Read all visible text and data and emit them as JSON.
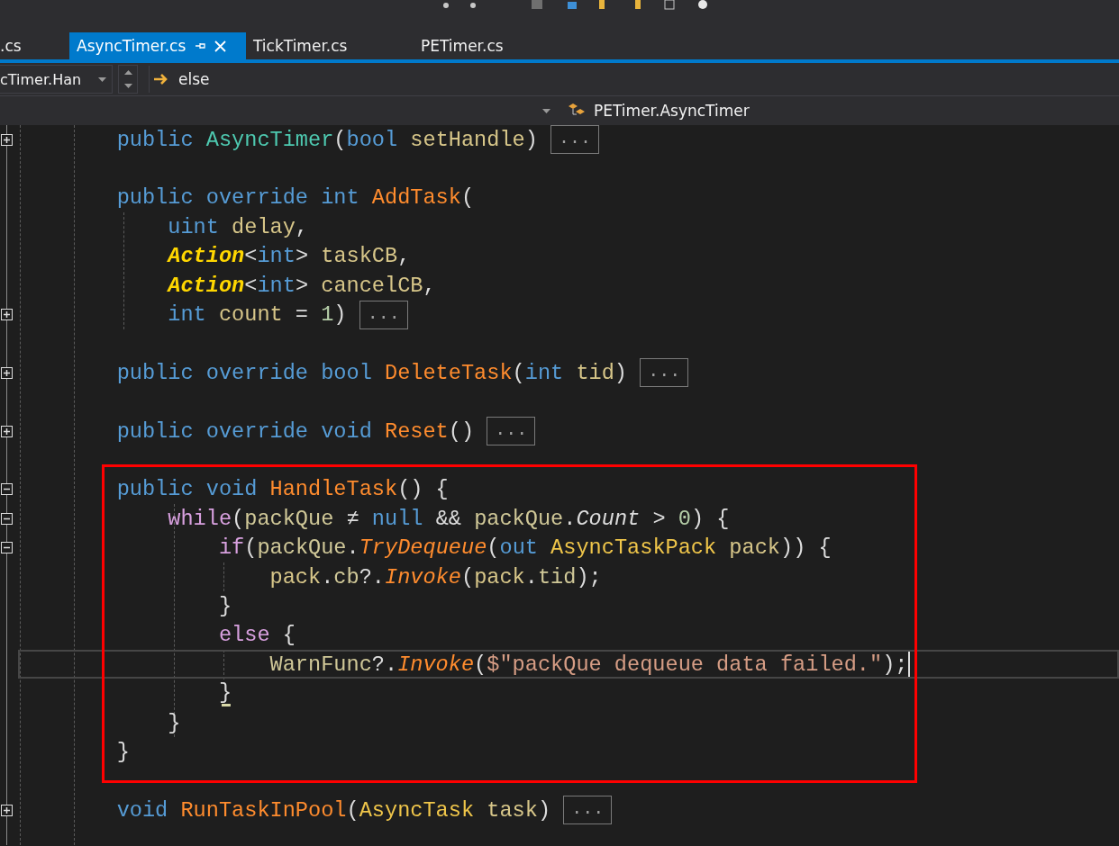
{
  "tabs": [
    {
      "label": ".cs",
      "selected": false
    },
    {
      "label": "AsyncTimer.cs",
      "selected": true
    },
    {
      "label": "TickTimer.cs",
      "selected": false
    },
    {
      "label": "PETimer.cs",
      "selected": false
    }
  ],
  "navigation": {
    "member": "cTimer.Han",
    "scope": "else",
    "type": "PETimer.AsyncTimer"
  },
  "code": {
    "lines_before_box": [
      {
        "collapsed": true,
        "current": false,
        "tokens": [
          {
            "text": "    public ",
            "kind": "kw"
          },
          {
            "text": "AsyncTimer",
            "kind": "cls"
          },
          {
            "text": "(",
            "kind": "pl"
          },
          {
            "text": "bool ",
            "kind": "kw"
          },
          {
            "text": "setHandle",
            "kind": "prm"
          },
          {
            "text": ") ",
            "kind": "pl"
          },
          {
            "text": "...",
            "kind": "collapsed"
          }
        ]
      },
      {
        "current": false
      },
      {
        "current": false,
        "tokens": [
          {
            "text": "    public override int ",
            "kind": "kw"
          },
          {
            "text": "AddTask",
            "kind": "fn"
          },
          {
            "text": "(",
            "kind": "pl"
          }
        ]
      },
      {
        "current": false,
        "tokens": [
          {
            "text": "        uint ",
            "kind": "kw"
          },
          {
            "text": "delay",
            "kind": "prm"
          },
          {
            "text": ",",
            "kind": "pl"
          }
        ]
      },
      {
        "current": false,
        "tokens": [
          {
            "text": "        Action",
            "kind": "dlg"
          },
          {
            "text": "<",
            "kind": "pl"
          },
          {
            "text": "int",
            "kind": "kw"
          },
          {
            "text": "> ",
            "kind": "pl"
          },
          {
            "text": "taskCB",
            "kind": "prm"
          },
          {
            "text": ",",
            "kind": "pl"
          }
        ]
      },
      {
        "current": false,
        "tokens": [
          {
            "text": "        Action",
            "kind": "dlg"
          },
          {
            "text": "<",
            "kind": "pl"
          },
          {
            "text": "int",
            "kind": "kw"
          },
          {
            "text": "> ",
            "kind": "pl"
          },
          {
            "text": "cancelCB",
            "kind": "prm"
          },
          {
            "text": ",",
            "kind": "pl"
          }
        ]
      },
      {
        "collapsed": true,
        "current": false,
        "tokens": [
          {
            "text": "        int ",
            "kind": "kw"
          },
          {
            "text": "count",
            "kind": "prm"
          },
          {
            "text": " = ",
            "kind": "pl"
          },
          {
            "text": "1",
            "kind": "num"
          },
          {
            "text": ") ",
            "kind": "pl"
          },
          {
            "text": "...",
            "kind": "collapsed"
          }
        ]
      },
      {
        "current": false
      },
      {
        "collapsed": true,
        "current": false,
        "tokens": [
          {
            "text": "    public override bool ",
            "kind": "kw"
          },
          {
            "text": "DeleteTask",
            "kind": "fn"
          },
          {
            "text": "(",
            "kind": "pl"
          },
          {
            "text": "int ",
            "kind": "kw"
          },
          {
            "text": "tid",
            "kind": "prm"
          },
          {
            "text": ") ",
            "kind": "pl"
          },
          {
            "text": "...",
            "kind": "collapsed"
          }
        ]
      },
      {
        "current": false
      },
      {
        "collapsed": true,
        "current": false,
        "tokens": [
          {
            "text": "    public override void ",
            "kind": "kw"
          },
          {
            "text": "Reset",
            "kind": "fn"
          },
          {
            "text": "() ",
            "kind": "pl"
          },
          {
            "text": "...",
            "kind": "collapsed"
          }
        ]
      },
      {
        "current": false
      }
    ],
    "boxed_lines": [
      {
        "collapsed": false,
        "current": false,
        "tokens": [
          {
            "text": "    public void ",
            "kind": "kw"
          },
          {
            "text": "HandleTask",
            "kind": "fn"
          },
          {
            "text": "() {",
            "kind": "pl"
          }
        ]
      },
      {
        "collapsed": false,
        "current": false,
        "tokens": [
          {
            "text": "        while",
            "kind": "ctl"
          },
          {
            "text": "(",
            "kind": "pl"
          },
          {
            "text": "packQue",
            "kind": "fld"
          },
          {
            "text": " ≠ ",
            "kind": "pl"
          },
          {
            "text": "null",
            "kind": "kw"
          },
          {
            "text": " && ",
            "kind": "pl"
          },
          {
            "text": "packQue",
            "kind": "fld"
          },
          {
            "text": ".",
            "kind": "pl"
          },
          {
            "text": "Count",
            "kind": "pi"
          },
          {
            "text": " > ",
            "kind": "pl"
          },
          {
            "text": "0",
            "kind": "num"
          },
          {
            "text": ") {",
            "kind": "pl"
          }
        ]
      },
      {
        "collapsed": false,
        "current": false,
        "tokens": [
          {
            "text": "            if",
            "kind": "ctl"
          },
          {
            "text": "(",
            "kind": "pl"
          },
          {
            "text": "packQue",
            "kind": "fld"
          },
          {
            "text": ".",
            "kind": "pl"
          },
          {
            "text": "TryDequeue",
            "kind": "fni"
          },
          {
            "text": "(",
            "kind": "pl"
          },
          {
            "text": "out ",
            "kind": "kw"
          },
          {
            "text": "AsyncTaskPack ",
            "kind": "st"
          },
          {
            "text": "pack",
            "kind": "prm"
          },
          {
            "text": ")) {",
            "kind": "pl"
          }
        ]
      },
      {
        "current": false,
        "tokens": [
          {
            "text": "                pack",
            "kind": "prm"
          },
          {
            "text": ".",
            "kind": "pl"
          },
          {
            "text": "cb",
            "kind": "fld"
          },
          {
            "text": "?.",
            "kind": "pl"
          },
          {
            "text": "Invoke",
            "kind": "fni"
          },
          {
            "text": "(",
            "kind": "pl"
          },
          {
            "text": "pack",
            "kind": "prm"
          },
          {
            "text": ".",
            "kind": "pl"
          },
          {
            "text": "tid",
            "kind": "fld"
          },
          {
            "text": ");",
            "kind": "pl"
          }
        ]
      },
      {
        "current": false,
        "tokens": [
          {
            "text": "            }",
            "kind": "pl"
          }
        ]
      },
      {
        "current": false,
        "tokens": [
          {
            "text": "            else",
            "kind": "ctl"
          },
          {
            "text": " {",
            "kind": "pl"
          }
        ]
      },
      {
        "current": true,
        "tokens": [
          {
            "text": "                WarnFunc",
            "kind": "fld"
          },
          {
            "text": "?.",
            "kind": "pl"
          },
          {
            "text": "Invoke",
            "kind": "fni"
          },
          {
            "text": "(",
            "kind": "pl"
          },
          {
            "text": "$\"packQue dequeue data failed.\"",
            "kind": "str"
          },
          {
            "text": ");",
            "kind": "pl"
          }
        ]
      },
      {
        "current": false,
        "tokens": [
          {
            "text": "            }",
            "kind": "brace"
          }
        ]
      },
      {
        "current": false,
        "tokens": [
          {
            "text": "        }",
            "kind": "pl"
          }
        ]
      },
      {
        "current": false,
        "tokens": [
          {
            "text": "    }",
            "kind": "pl"
          }
        ]
      }
    ],
    "lines_after_box": [
      {
        "current": false
      },
      {
        "collapsed": true,
        "current": false,
        "tokens": [
          {
            "text": "    void ",
            "kind": "kw"
          },
          {
            "text": "RunTaskInPool",
            "kind": "fn"
          },
          {
            "text": "(",
            "kind": "pl"
          },
          {
            "text": "AsyncTask ",
            "kind": "st"
          },
          {
            "text": "task",
            "kind": "prm"
          },
          {
            "text": ") ",
            "kind": "pl"
          },
          {
            "text": "...",
            "kind": "collapsed"
          }
        ]
      }
    ]
  }
}
